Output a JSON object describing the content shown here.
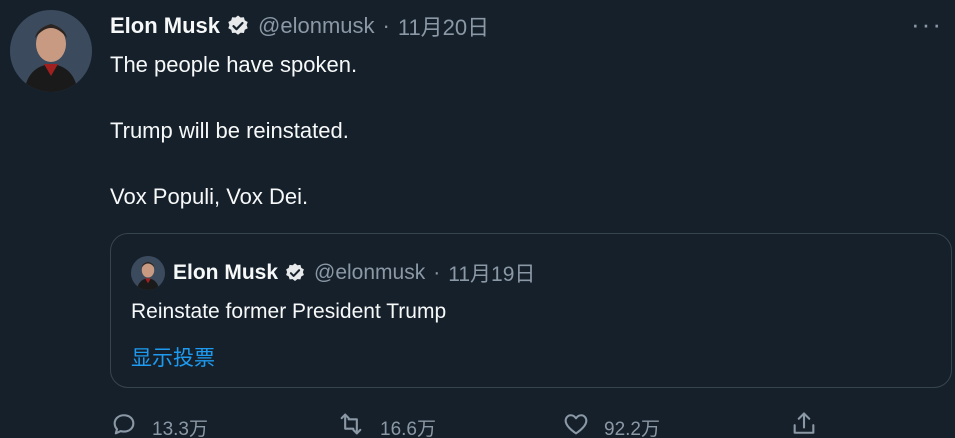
{
  "tweet": {
    "author_name": "Elon Musk",
    "handle": "@elonmusk",
    "separator": "·",
    "date": "11月20日",
    "more_label": "···",
    "lines": [
      "The people have spoken.",
      "Trump will be reinstated.",
      "Vox Populi, Vox Dei."
    ]
  },
  "quote": {
    "author_name": "Elon Musk",
    "handle": "@elonmusk",
    "separator": "·",
    "date": "11月19日",
    "text": "Reinstate former President Trump",
    "link": "显示投票"
  },
  "actions": {
    "replies": "13.3万",
    "retweets": "16.6万",
    "likes": "92.2万"
  },
  "icons": {
    "verified": "verified-badge-icon",
    "more": "more-icon",
    "reply": "reply-icon",
    "retweet": "retweet-icon",
    "like": "heart-icon",
    "share": "share-icon"
  },
  "colors": {
    "background": "#15202b",
    "text": "#f7f9f9",
    "secondary": "#8b98a5",
    "link": "#1d9bf0",
    "border": "#38444d",
    "verified": "#e7e9ea"
  }
}
